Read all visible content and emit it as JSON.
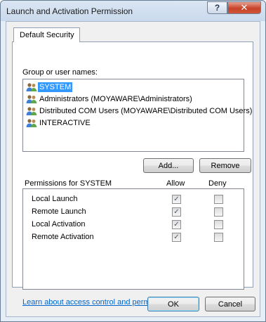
{
  "window": {
    "title": "Launch and Activation Permission"
  },
  "caption_buttons": {
    "help": "?",
    "close": "✕"
  },
  "tabs": [
    {
      "label": "Default Security"
    }
  ],
  "group": {
    "label": "Group or user names:",
    "items": [
      {
        "label": "SYSTEM",
        "selected": true,
        "icon": "user-group-icon"
      },
      {
        "label": "Administrators (MOYAWARE\\Administrators)",
        "selected": false,
        "icon": "user-group-icon"
      },
      {
        "label": "Distributed COM Users (MOYAWARE\\Distributed COM Users)",
        "selected": false,
        "icon": "user-group-icon"
      },
      {
        "label": "INTERACTIVE",
        "selected": false,
        "icon": "user-group-icon"
      }
    ]
  },
  "buttons": {
    "add": "Add...",
    "remove": "Remove",
    "ok": "OK",
    "cancel": "Cancel"
  },
  "permissions": {
    "title": "Permissions for SYSTEM",
    "allow_header": "Allow",
    "deny_header": "Deny",
    "rows": [
      {
        "label": "Local Launch",
        "allow": true,
        "deny": false
      },
      {
        "label": "Remote Launch",
        "allow": true,
        "deny": false
      },
      {
        "label": "Local Activation",
        "allow": true,
        "deny": false
      },
      {
        "label": "Remote Activation",
        "allow": true,
        "deny": false
      }
    ]
  },
  "link": {
    "label": "Learn about access control and permissions"
  },
  "colors": {
    "selection": "#3399ff",
    "link": "#0066cc",
    "close_button": "#c7432a"
  }
}
